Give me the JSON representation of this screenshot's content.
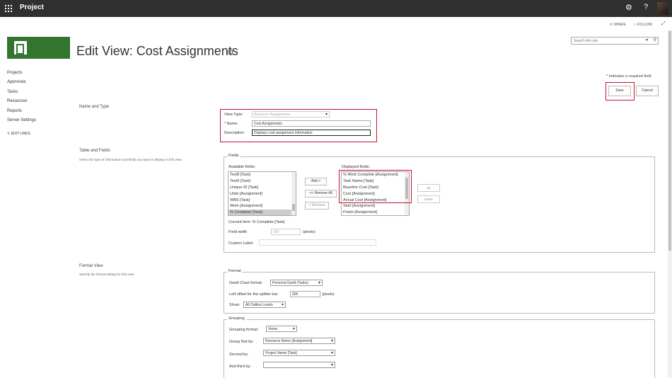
{
  "app": {
    "name": "Project"
  },
  "topbar": {
    "settings_icon": "gear-icon",
    "help_label": "?"
  },
  "social": {
    "share": "SHARE",
    "follow": "FOLLOW"
  },
  "page": {
    "title": "Edit View: Cost Assignments"
  },
  "search": {
    "placeholder": "Search this site"
  },
  "nav": {
    "items": [
      "Projects",
      "Approvals",
      "Tasks",
      "Resources",
      "Reports",
      "Server Settings"
    ],
    "edit_links": "EDIT LINKS"
  },
  "required_note": {
    "asterisk": "*",
    "text": "Indicates a required field"
  },
  "buttons": {
    "save": "Save",
    "cancel": "Cancel"
  },
  "name_type": {
    "title": "Name and Type",
    "view_type_label": "View Type:",
    "view_type_value": "Resource Assignments",
    "name_label": "Name:",
    "name_value": "Cost Assignments",
    "description_label": "Description:",
    "description_value": "Displays cost assignment information"
  },
  "table_fields": {
    "title": "Table and Fields",
    "desc": "Select the type of information and fields you want to display in this view.",
    "legend": "Fields",
    "available_label": "Available fields:",
    "available": [
      "Text8 [Task]",
      "Text9 [Task]",
      "Unique ID [Task]",
      "Units [Assignment]",
      "WBS [Task]",
      "Work [Assignment]",
      "% Complete [Task]"
    ],
    "displayed_label": "Displayed fields:",
    "displayed": [
      "% Work Complete [Assignment]",
      "Task Name [Task]",
      "Baseline Cost [Task]",
      "Cost [Assignment]",
      "Actual Cost [Assignment]",
      "Start [Assignment]",
      "Finish [Assignment]"
    ],
    "add": "Add >",
    "remove_all": "<< Remove All",
    "remove": "< Remove",
    "up": "Up",
    "down": "Down",
    "current_item": "Current Item: % Complete [Task]",
    "field_width_label": "Field width",
    "field_width_value": "100",
    "pixels": "(pixels)",
    "custom_label": "Custom Label:"
  },
  "format_view": {
    "title": "Format View",
    "desc": "Specify the format setting for this view.",
    "legend": "Format",
    "gantt_label": "Gantt Chart format:",
    "gantt_value": "Personal Gantt (Tasks)",
    "offset_label": "Left offset for the splitter bar:",
    "offset_value": "600",
    "pixels": "(pixels)",
    "show_label": "Show:",
    "show_value": "All Outline Levels"
  },
  "grouping": {
    "legend": "Grouping",
    "format_label": "Grouping format:",
    "format_value": "Views",
    "first_label": "Group first by:",
    "first_value": "Resource Name [Assignment]",
    "second_label": "Second by:",
    "second_value": "Project Name [Task]",
    "third_label": "And third by:",
    "third_value": ""
  },
  "colors": {
    "topbar": "#2f2f2f",
    "brand": "#31752f",
    "highlight": "#c8102e"
  }
}
